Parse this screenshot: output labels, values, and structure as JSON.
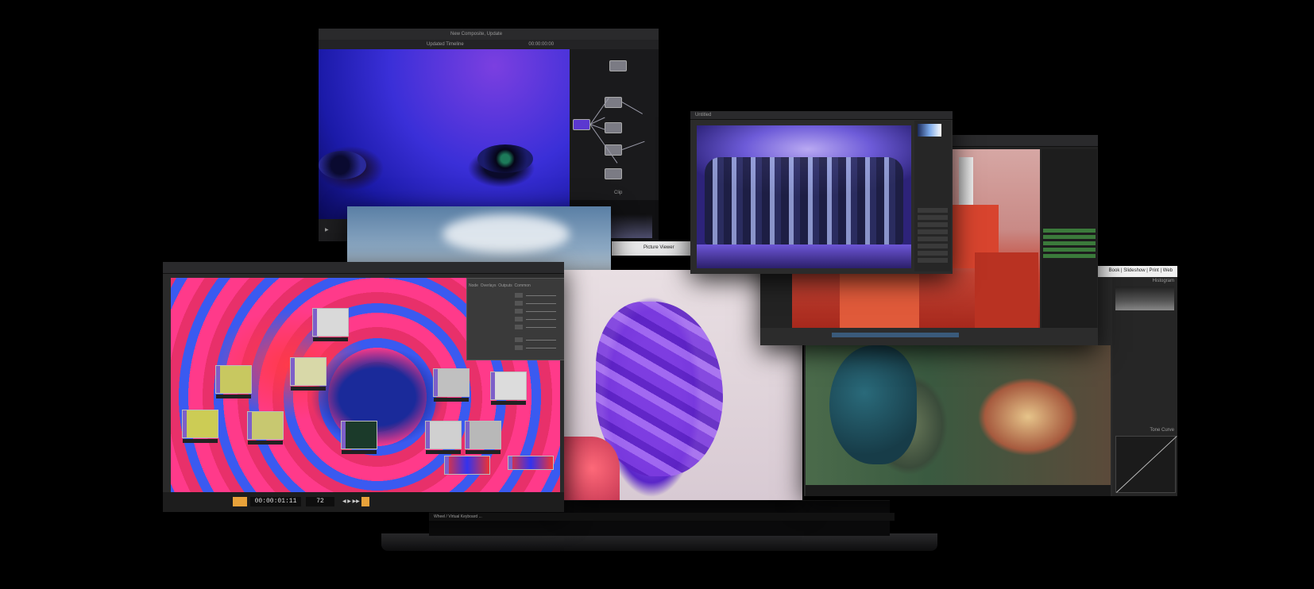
{
  "resolve": {
    "title": "New Composite, Update",
    "timeline_label": "Updated Timeline",
    "timecode": "00:00:00:00",
    "viewer_label": "Picture Viewer",
    "nodes_label": "Clip"
  },
  "touchdesigner": {
    "timecode": "00:00:01:11",
    "frame": "72",
    "panel_tabs": [
      "Node",
      "Overlays",
      "Outputs",
      "Common"
    ],
    "status": "Wheel / Virtual Keyboard ..."
  },
  "lightroom": {
    "modules": [
      "Book",
      "Slideshow",
      "Print",
      "Web"
    ],
    "panel_title": "Histogram",
    "curve_title": "Tone Curve"
  },
  "photoshop": {
    "title": "Untitled"
  },
  "colors": {
    "desktop": "#000000",
    "accent_orange": "#e8a23a",
    "node_purple": "#7d5fc9"
  }
}
